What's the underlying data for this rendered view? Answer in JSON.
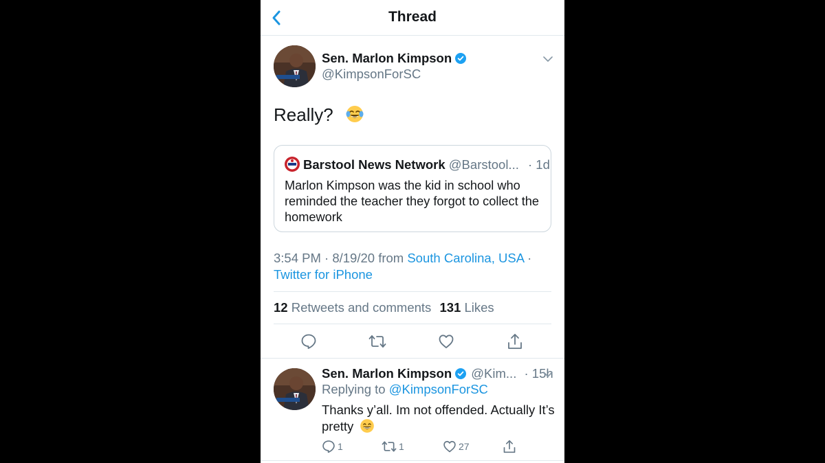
{
  "header": {
    "title": "Thread"
  },
  "main_tweet": {
    "name": "Sen. Marlon Kimpson",
    "handle": "@KimpsonForSC",
    "text": "Really?",
    "emoji": "face-with-tears-of-joy",
    "quoted": {
      "name": "Barstool News Network",
      "handle": "@Barstool...",
      "time": "· 1d",
      "text": "Marlon Kimpson was the kid in school who reminded the teacher they forgot to collect the homework"
    },
    "timestamp": "3:54 PM · 8/19/20 from ",
    "location": "South Carolina, USA",
    "location_sep": " ·",
    "source": "Twitter for iPhone",
    "retweets_count": "12",
    "retweets_label": "Retweets and comments",
    "likes_count": "131",
    "likes_label": "Likes"
  },
  "reply_tweet": {
    "name": "Sen. Marlon Kimpson",
    "handle": "@Kim...",
    "time": "· 15h",
    "replying_label": "Replying to ",
    "replying_handle": "@KimpsonForSC",
    "text": "Thanks y’all.  Im not offended.  Actually It’s pretty",
    "emoji": "grinning-face",
    "reply_count": "1",
    "retweet_count": "1",
    "like_count": "27"
  },
  "colors": {
    "accent": "#1b95e0",
    "text": "#14171a",
    "muted": "#657786",
    "border": "#e1e8ed"
  }
}
